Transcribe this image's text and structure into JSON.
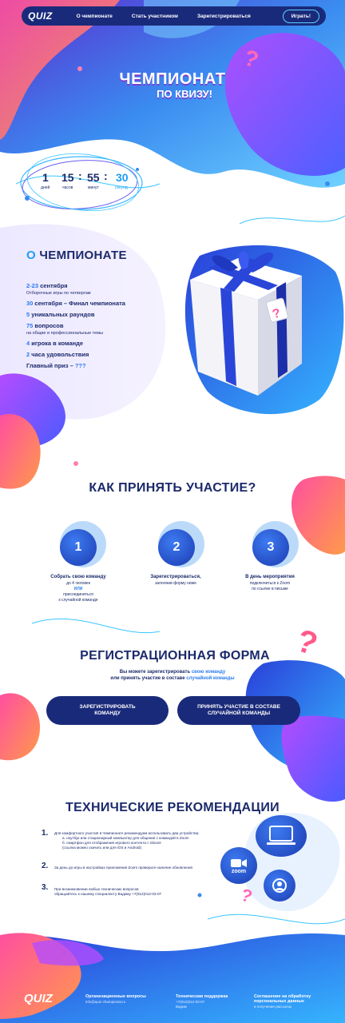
{
  "nav": {
    "logo": "QUIZ",
    "links": [
      "О чемпионате",
      "Стать участником",
      "Зарегистрироваться"
    ],
    "play_label": "Играть!"
  },
  "hero": {
    "title": "ЧЕМПИОНАТ",
    "subtitle": "ПО КВИЗУ!"
  },
  "timer": {
    "days": "1",
    "hours": "15",
    "minutes": "55",
    "seconds": "30",
    "days_label": "дней",
    "hours_label": "часов",
    "minutes_label": "минут",
    "seconds_label": "секунд",
    "sep": ":"
  },
  "about": {
    "title_prefix": "О",
    "title_rest": " ЧЕМПИОНАТЕ",
    "items": [
      {
        "hl": "2-23",
        "text": " сентября",
        "sub": "Отборочные игры по четвергам"
      },
      {
        "hl": "30",
        "text": " сентября – Финал чемпионата",
        "sub": ""
      },
      {
        "hl": "5",
        "text": " уникальных раундов",
        "sub": ""
      },
      {
        "hl": "75",
        "text": " вопросов",
        "sub": "на общие и профессиональные темы"
      },
      {
        "hl": "4",
        "text": " игрока в команде",
        "sub": ""
      },
      {
        "hl": "2",
        "text": " часа удовольствия",
        "sub": ""
      },
      {
        "hl": "???",
        "text": "Главный приз – ",
        "sub": ""
      }
    ]
  },
  "how": {
    "title": "КАК ПРИНЯТЬ УЧАСТИЕ?",
    "steps": [
      {
        "num": "1",
        "title": "Собрать свою команду",
        "l1": "до 4 человек",
        "l2": "ИЛИ",
        "l3": "присоединиться",
        "l4": "к случайной команде"
      },
      {
        "num": "2",
        "title": "Зарегистрироваться,",
        "l1": "заполнив форму ниже",
        "l2": "",
        "l3": "",
        "l4": ""
      },
      {
        "num": "3",
        "title": "В день мероприятия",
        "l1": "подключиться к Zoom",
        "l2": "по ссылке в письме",
        "l3": "",
        "l4": ""
      }
    ]
  },
  "registration": {
    "title": "РЕГИСТРАЦИОННАЯ ФОРМА",
    "desc1_a": "Вы можете зарегистрировать ",
    "desc1_hl": "свою команду",
    "desc2_a": "или принять участие в составе ",
    "desc2_hl": "случайной команды",
    "btn1": "ЗАРЕГИСТРИРОВАТЬ КОМАНДУ",
    "btn2": "ПРИНЯТЬ УЧАСТИЕ В СОСТАВЕ СЛУЧАЙНОЙ КОМАНДЫ"
  },
  "tech": {
    "title": "ТЕХНИЧЕСКИЕ РЕКОМЕНДАЦИИ",
    "items": [
      {
        "num": "1.",
        "text": "Для комфортного участия в Чемпионате рекомендуем использовать два устройства:",
        "l2": "а. ноутбук или стационарный компьютер для общения с командой в Zoom",
        "l3": "б. смартфон для отображения игрового контента с Slooze",
        "l4": "(ссылка можно скачать или для iOS и Android)"
      },
      {
        "num": "2.",
        "text": "За день до игры в настройках приложения Zoom проверьте наличие обновления",
        "l2": "",
        "l3": "",
        "l4": ""
      },
      {
        "num": "3.",
        "text": "При возникновении любых технических вопросов",
        "l2": "обращайтесь к нашему специалисту Вадиму +7(912)012-03-07",
        "l3": "",
        "l4": ""
      }
    ],
    "zoom_label": "zoom"
  },
  "footer": {
    "logo": "QUIZ",
    "col1_h": "Организационные вопросы",
    "col1_s": "info@quiz-championat.ru",
    "col2_h": "Техническая поддержка",
    "col2_s1": "+7(912)012-03-07",
    "col2_s2": "Вадим",
    "col3_h": "Соглашение на обработку",
    "col3_h2": "персональных данных",
    "col3_s": "и получение рассылок"
  },
  "colors": {
    "navy": "#1a2a7a",
    "accent": "#2b7cf0",
    "text": "#1b2a6b"
  }
}
